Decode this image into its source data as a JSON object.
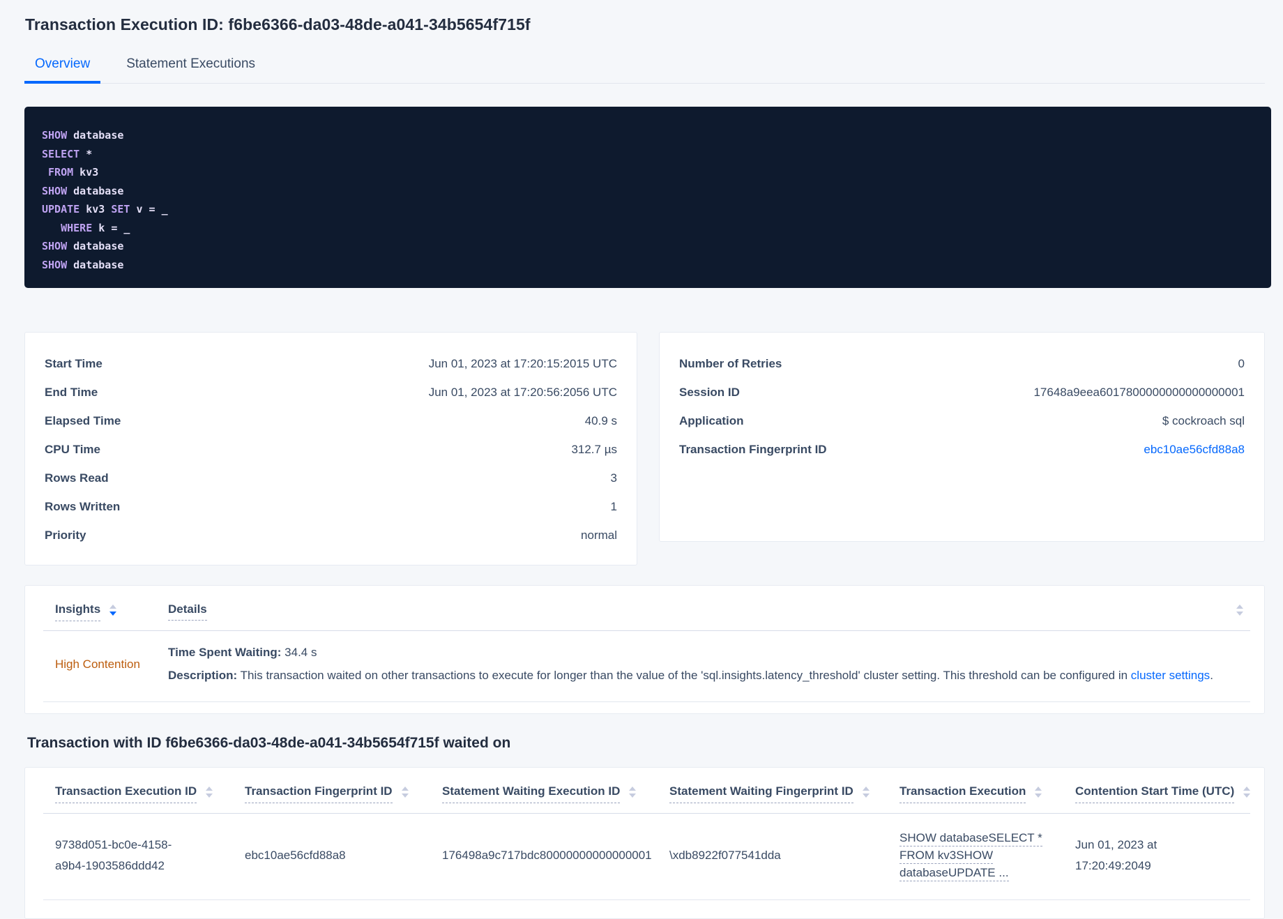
{
  "page_title": "Transaction Execution ID: f6be6366-da03-48de-a041-34b5654f715f",
  "tabs": {
    "overview": "Overview",
    "statement_executions": "Statement Executions"
  },
  "sql_box": {
    "lines": [
      [
        {
          "k": "kw",
          "t": "SHOW"
        },
        {
          "k": "tx",
          "t": " database"
        }
      ],
      [
        {
          "k": "kw",
          "t": "SELECT"
        },
        {
          "k": "tx",
          "t": " *"
        }
      ],
      [
        {
          "k": "tx",
          "t": " "
        },
        {
          "k": "kw",
          "t": "FROM"
        },
        {
          "k": "tx",
          "t": " kv3"
        }
      ],
      [
        {
          "k": "kw",
          "t": "SHOW"
        },
        {
          "k": "tx",
          "t": " database"
        }
      ],
      [
        {
          "k": "kw",
          "t": "UPDATE"
        },
        {
          "k": "tx",
          "t": " kv3 "
        },
        {
          "k": "kw",
          "t": "SET"
        },
        {
          "k": "tx",
          "t": " v = _"
        }
      ],
      [
        {
          "k": "tx",
          "t": "   "
        },
        {
          "k": "kw",
          "t": "WHERE"
        },
        {
          "k": "tx",
          "t": " k = _"
        }
      ],
      [
        {
          "k": "kw",
          "t": "SHOW"
        },
        {
          "k": "tx",
          "t": " database"
        }
      ],
      [
        {
          "k": "kw",
          "t": "SHOW"
        },
        {
          "k": "tx",
          "t": " database"
        }
      ]
    ]
  },
  "summary_left": {
    "rows": [
      {
        "label": "Start Time",
        "value": "Jun 01, 2023 at 17:20:15:2015 UTC"
      },
      {
        "label": "End Time",
        "value": "Jun 01, 2023 at 17:20:56:2056 UTC"
      },
      {
        "label": "Elapsed Time",
        "value": "40.9 s"
      },
      {
        "label": "CPU Time",
        "value": "312.7 µs"
      },
      {
        "label": "Rows Read",
        "value": "3"
      },
      {
        "label": "Rows Written",
        "value": "1"
      },
      {
        "label": "Priority",
        "value": "normal"
      }
    ]
  },
  "summary_right": {
    "rows": [
      {
        "label": "Number of Retries",
        "value": "0"
      },
      {
        "label": "Session ID",
        "value": "17648a9eea6017800000000000000001"
      },
      {
        "label": "Application",
        "value": "$ cockroach sql"
      },
      {
        "label": "Transaction Fingerprint ID",
        "value": "ebc10ae56cfd88a8",
        "link": true
      }
    ]
  },
  "insights": {
    "header_insights": "Insights",
    "header_details": "Details",
    "row": {
      "insight": "High Contention",
      "waiting_label": "Time Spent Waiting:",
      "waiting_value": " 34.4 s",
      "description_label": "Description:",
      "description_text": " This transaction waited on other transactions to execute for longer than the value of the 'sql.insights.latency_threshold' cluster setting. This threshold can be configured in ",
      "description_link": "cluster settings",
      "description_suffix": "."
    }
  },
  "waited_on": {
    "heading": "Transaction with ID f6be6366-da03-48de-a041-34b5654f715f waited on",
    "columns": [
      "Transaction Execution ID",
      "Transaction Fingerprint ID",
      "Statement Waiting Execution ID",
      "Statement Waiting Fingerprint ID",
      "Transaction Execution",
      "Contention Start Time (UTC)"
    ],
    "row": {
      "transaction_execution_id": "9738d051-bc0e-4158-a9b4-1903586ddd42",
      "transaction_fingerprint_id": "ebc10ae56cfd88a8",
      "statement_waiting_execution_id": "176498a9c717bdc80000000000000001",
      "statement_waiting_fingerprint_id": "\\xdb8922f077541dda",
      "transaction_execution": [
        "SHOW databaseSELECT *",
        "FROM kv3SHOW",
        "databaseUPDATE ..."
      ],
      "contention_start_time": "Jun 01, 2023 at 17:20:49:2049"
    }
  },
  "colors": {
    "accent_blue": "#0568fd",
    "high_contention_orange": "#bc5d0e",
    "sql_keyword_purple": "#bfa3f2",
    "sql_text_lavender": "#e4dff7",
    "sql_box_background": "#0e1a2e",
    "page_background": "#f5f7fa",
    "text_slate": "#394a63"
  }
}
